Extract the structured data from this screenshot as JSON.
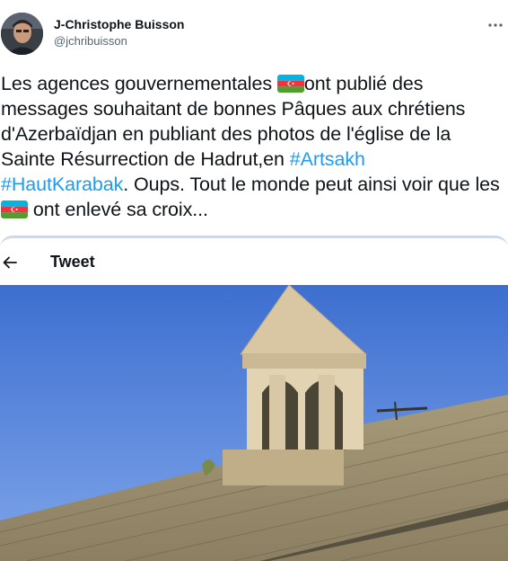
{
  "author": {
    "display_name": "J-Christophe Buisson",
    "handle": "@jchribuisson"
  },
  "tweet": {
    "seg1": "Les agences gouvernementales ",
    "seg2": "ont publié des messages souhaitant de bonnes Pâques aux chrétiens d'Azerbaïdjan en publiant des photos de l'église de la Sainte Résurrection de Hadrut,en ",
    "hashtag1": "#Artsakh",
    "hashtag2": "#HautKarabak",
    "seg3": ". Oups. Tout le monde peut ainsi voir que les ",
    "seg4": " ont enlevé sa croix..."
  },
  "embed": {
    "title": "Tweet"
  },
  "icons": {
    "more": "more-dots-icon",
    "back": "arrow-left-icon",
    "flag": "azerbaijan-flag-icon"
  },
  "colors": {
    "link": "#1d9bf0",
    "text": "#0f1419",
    "secondary": "#536471"
  }
}
